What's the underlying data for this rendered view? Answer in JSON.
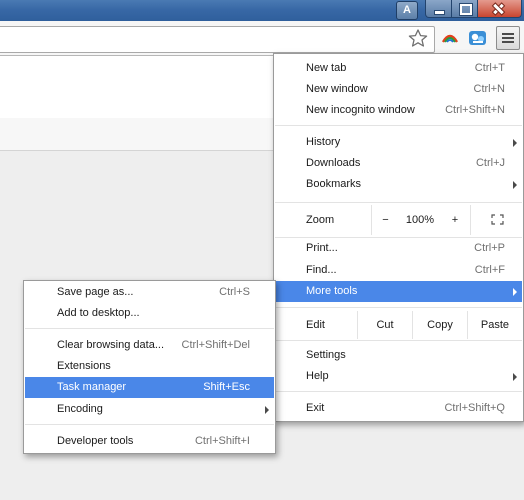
{
  "titlebar": {
    "profile_letter": "A"
  },
  "toolbar": {
    "icons": [
      "bookmark-star-icon",
      "extension-icon",
      "extension-icon-2",
      "chrome-menu-icon"
    ]
  },
  "main_menu": {
    "new_tab": {
      "label": "New tab",
      "shortcut": "Ctrl+T"
    },
    "new_window": {
      "label": "New window",
      "shortcut": "Ctrl+N"
    },
    "new_incognito": {
      "label": "New incognito window",
      "shortcut": "Ctrl+Shift+N"
    },
    "history": {
      "label": "History"
    },
    "downloads": {
      "label": "Downloads",
      "shortcut": "Ctrl+J"
    },
    "bookmarks": {
      "label": "Bookmarks"
    },
    "zoom": {
      "label": "Zoom",
      "minus": "−",
      "value": "100%",
      "plus": "+"
    },
    "print": {
      "label": "Print...",
      "shortcut": "Ctrl+P"
    },
    "find": {
      "label": "Find...",
      "shortcut": "Ctrl+F"
    },
    "more_tools": {
      "label": "More tools"
    },
    "edit": {
      "label": "Edit",
      "cut": "Cut",
      "copy": "Copy",
      "paste": "Paste"
    },
    "settings": {
      "label": "Settings"
    },
    "help": {
      "label": "Help"
    },
    "exit": {
      "label": "Exit",
      "shortcut": "Ctrl+Shift+Q"
    }
  },
  "sub_menu": {
    "save_page": {
      "label": "Save page as...",
      "shortcut": "Ctrl+S"
    },
    "add_desktop": {
      "label": "Add to desktop..."
    },
    "clear_data": {
      "label": "Clear browsing data...",
      "shortcut": "Ctrl+Shift+Del"
    },
    "extensions": {
      "label": "Extensions"
    },
    "task_manager": {
      "label": "Task manager",
      "shortcut": "Shift+Esc"
    },
    "encoding": {
      "label": "Encoding"
    },
    "developer_tools": {
      "label": "Developer tools",
      "shortcut": "Ctrl+Shift+I"
    }
  },
  "colors": {
    "highlight": "#4a87e8",
    "titlebar": "#3868a6"
  }
}
